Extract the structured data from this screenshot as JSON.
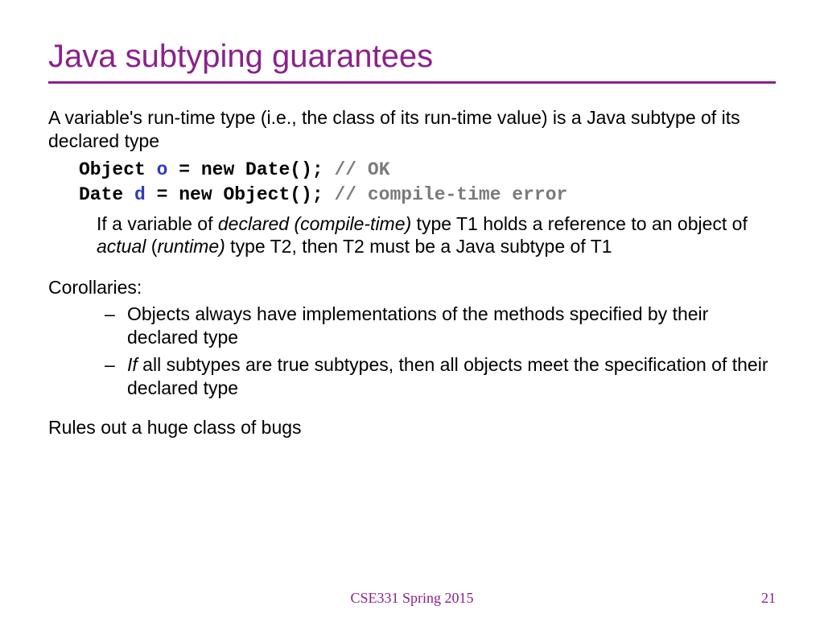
{
  "title": "Java subtyping guarantees",
  "intro": "A variable's run-time type (i.e., the class of its run-time value) is a Java subtype of its declared type",
  "code": {
    "l1": {
      "p1": "Object ",
      "var": "o",
      "p2": " = new Date(); ",
      "comment": "// OK"
    },
    "l2": {
      "p1": "Date ",
      "var": "d",
      "p2": " = new Object(); ",
      "comment": "// compile-time error"
    }
  },
  "explain": {
    "s1": "If a variable of ",
    "i1": "declared (compile-time)",
    "s2": " type T1 holds a reference to an object of ",
    "i2": "actual",
    "s3": " (",
    "i3": "runtime)",
    "s4": " type T2, then T2 must be a Java subtype of T1"
  },
  "corollaries_label": "Corollaries:",
  "bullets": {
    "b1": "Objects always have implementations of the methods specified by their declared type",
    "b2_i": "If",
    "b2_r": " all subtypes are true subtypes, then all objects meet the specification of their declared type"
  },
  "closing": "Rules out a huge class of bugs",
  "footer": {
    "course": "CSE331 Spring 2015",
    "page": "21"
  }
}
